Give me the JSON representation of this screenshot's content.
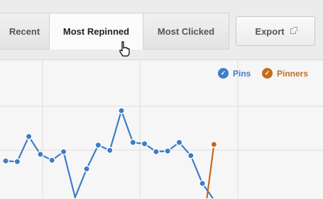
{
  "tabs": [
    {
      "label": "Recent",
      "active": false
    },
    {
      "label": "Most Repinned",
      "active": true
    },
    {
      "label": "Most Clicked",
      "active": false
    }
  ],
  "export": {
    "label": "Export",
    "icon": "external-link-icon"
  },
  "legend": [
    {
      "label": "Pins",
      "color": "#3f7dc5",
      "checked": true
    },
    {
      "label": "Pinners",
      "color": "#c46b1f",
      "checked": true
    }
  ],
  "colors": {
    "pins": "#3f7dc5",
    "pinners": "#c46b1f",
    "grid": "#dddddd"
  },
  "chart_data": {
    "type": "line",
    "series": [
      {
        "name": "Pins",
        "color": "#3f7dc5",
        "values": [
          214,
          213,
          251,
          224,
          215,
          228,
          159,
          202,
          238,
          230,
          290,
          242,
          240,
          228,
          229,
          242,
          222,
          180,
          155
        ]
      },
      {
        "name": "Pinners",
        "color": "#c46b1f",
        "values": [
          null,
          null,
          null,
          null,
          null,
          null,
          null,
          null,
          null,
          null,
          null,
          null,
          null,
          null,
          null,
          null,
          null,
          null,
          239
        ]
      }
    ],
    "grid": true,
    "legend_position": "top-right"
  }
}
